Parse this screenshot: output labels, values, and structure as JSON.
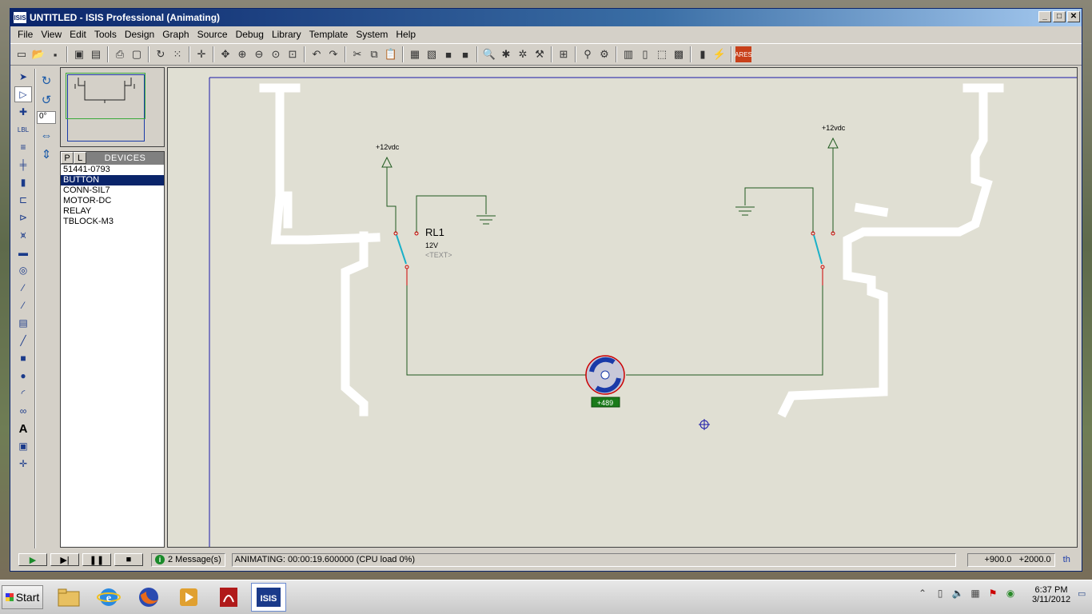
{
  "window": {
    "title": "UNTITLED - ISIS Professional (Animating)",
    "app_icon_text": "ISIS",
    "minimize": "_",
    "maximize": "□",
    "close": "✕"
  },
  "menu": [
    "File",
    "View",
    "Edit",
    "Tools",
    "Design",
    "Graph",
    "Source",
    "Debug",
    "Library",
    "Template",
    "System",
    "Help"
  ],
  "rotation": {
    "angle_value": "0°"
  },
  "device_panel": {
    "p_label": "P",
    "l_label": "L",
    "title": "DEVICES",
    "items": [
      "51441-0793",
      "BUTTON",
      "CONN-SIL7",
      "MOTOR-DC",
      "RELAY",
      "TBLOCK-M3"
    ],
    "selected": "BUTTON"
  },
  "schematic": {
    "left_supply_label": "+12vdc",
    "right_supply_label": "+12vdc",
    "relay_name": "RL1",
    "relay_value": "12V",
    "relay_text": "<TEXT>",
    "motor_readout": "+489"
  },
  "status": {
    "messages": "2 Message(s)",
    "animating": "ANIMATING: 00:00:19.600000 (CPU load 0%)",
    "coord_x": "+900.0",
    "coord_y": "+2000.0",
    "unit": "th"
  },
  "taskbar": {
    "start_label": "Start",
    "time": "6:37 PM",
    "date": "3/11/2012",
    "active_app": "ISIS"
  },
  "colors": {
    "titlebar": "#0a246a",
    "wire": "#1f5a1f",
    "canvas": "#e0dfd3",
    "motor": "#1a3aa8",
    "readout": "#1a8a2a"
  }
}
